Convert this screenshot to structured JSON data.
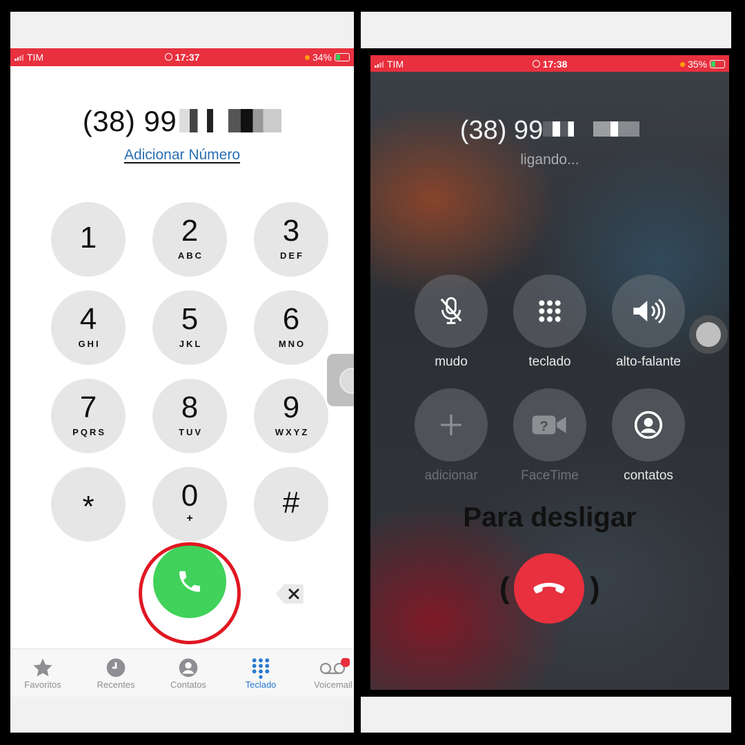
{
  "left_screen": {
    "status_bar": {
      "carrier": "TIM",
      "time": "17:37",
      "battery": "34%"
    },
    "dialed_number": "(38) 99",
    "add_number_link": "Adicionar Número",
    "keypad": [
      {
        "digit": "1",
        "letters": ""
      },
      {
        "digit": "2",
        "letters": "ABC"
      },
      {
        "digit": "3",
        "letters": "DEF"
      },
      {
        "digit": "4",
        "letters": "GHI"
      },
      {
        "digit": "5",
        "letters": "JKL"
      },
      {
        "digit": "6",
        "letters": "MNO"
      },
      {
        "digit": "7",
        "letters": "PQRS"
      },
      {
        "digit": "8",
        "letters": "TUV"
      },
      {
        "digit": "9",
        "letters": "WXYZ"
      },
      {
        "digit": "*",
        "letters": ""
      },
      {
        "digit": "0",
        "letters": "+"
      },
      {
        "digit": "#",
        "letters": ""
      }
    ],
    "tabs": [
      {
        "label": "Favoritos",
        "icon": "star-icon"
      },
      {
        "label": "Recentes",
        "icon": "clock-icon"
      },
      {
        "label": "Contatos",
        "icon": "person-icon"
      },
      {
        "label": "Teclado",
        "icon": "keypad-icon",
        "active": true
      },
      {
        "label": "Voicemail",
        "icon": "voicemail-icon"
      }
    ],
    "accent_color": "#2a7ad1",
    "call_color": "#40d25b"
  },
  "right_screen": {
    "status_bar": {
      "carrier": "TIM",
      "time": "17:38",
      "battery": "35%"
    },
    "number": "(38) 99",
    "call_status": "ligando...",
    "controls": [
      {
        "label": "mudo",
        "icon": "mic-slash-icon"
      },
      {
        "label": "teclado",
        "icon": "keypad-icon"
      },
      {
        "label": "alto-falante",
        "icon": "speaker-icon"
      },
      {
        "label": "adicionar",
        "icon": "plus-icon",
        "disabled": true
      },
      {
        "label": "FaceTime",
        "icon": "facetime-icon",
        "disabled": true
      },
      {
        "label": "contatos",
        "icon": "contact-icon"
      }
    ],
    "hangup_caption": "Para desligar",
    "paren_open": "(",
    "paren_close": ")",
    "end_color": "#e8303e"
  }
}
